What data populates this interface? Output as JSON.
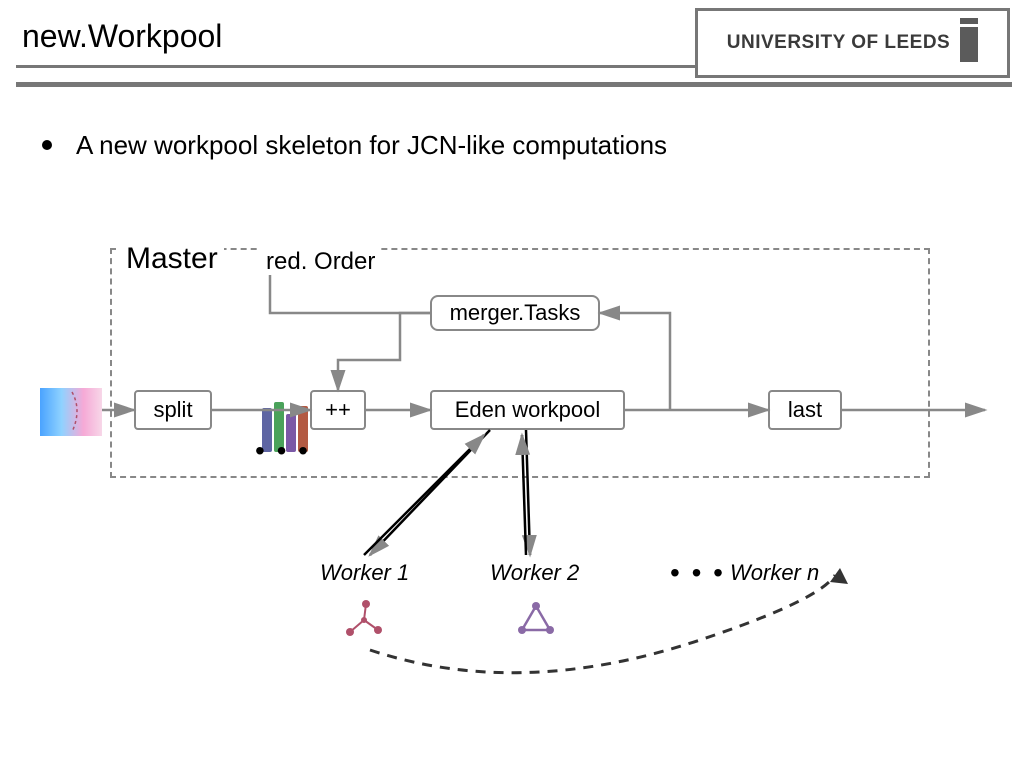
{
  "header": {
    "title": "new.Workpool",
    "logo_text": "UNIVERSITY OF LEEDS"
  },
  "bullet": {
    "text": "A new workpool skeleton for JCN-like computations"
  },
  "diagram": {
    "master_label": "Master",
    "red_order": "red. Order",
    "merger": "merger.Tasks",
    "split": "split",
    "concat": "++",
    "eden": "Eden workpool",
    "last": "last",
    "workers": {
      "w1": "Worker 1",
      "w2": "Worker 2",
      "wn": "Worker n",
      "ellipsis": "• • •"
    },
    "bars_ellipsis": "• • •"
  }
}
